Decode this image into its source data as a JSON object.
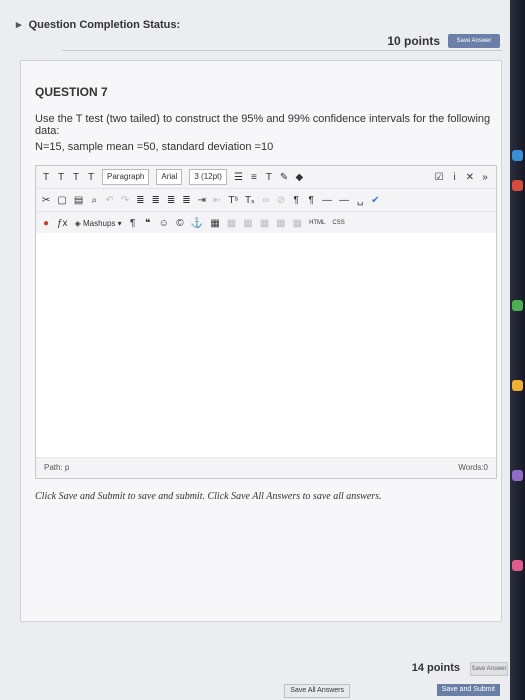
{
  "status": {
    "label": "Question Completion Status:"
  },
  "points_top": {
    "text": "10 points",
    "save_answer": "Save Answer"
  },
  "question": {
    "title": "QUESTION 7",
    "text": "Use the T test (two tailed) to construct the 95% and 99% confidence intervals for the following data:",
    "data": "N=15, sample mean =50, standard deviation =10"
  },
  "editor": {
    "format_select": "Paragraph",
    "font_select": "Arial",
    "size_select": "3 (12pt)",
    "mashups_label": "Mashups",
    "html_label": "HTML",
    "css_label": "CSS",
    "path_label": "Path: p",
    "words_label": "Words:0"
  },
  "instructions": "Click Save and Submit to save and submit. Click Save All Answers to save all answers.",
  "points_bottom": {
    "text": "14 points",
    "save_answer": "Save Answer"
  },
  "buttons": {
    "save_all": "Save All Answers",
    "save_submit": "Save and Submit"
  },
  "colors": {
    "submit_button": "#6a7fa5",
    "panel": "#f7f7f9"
  }
}
